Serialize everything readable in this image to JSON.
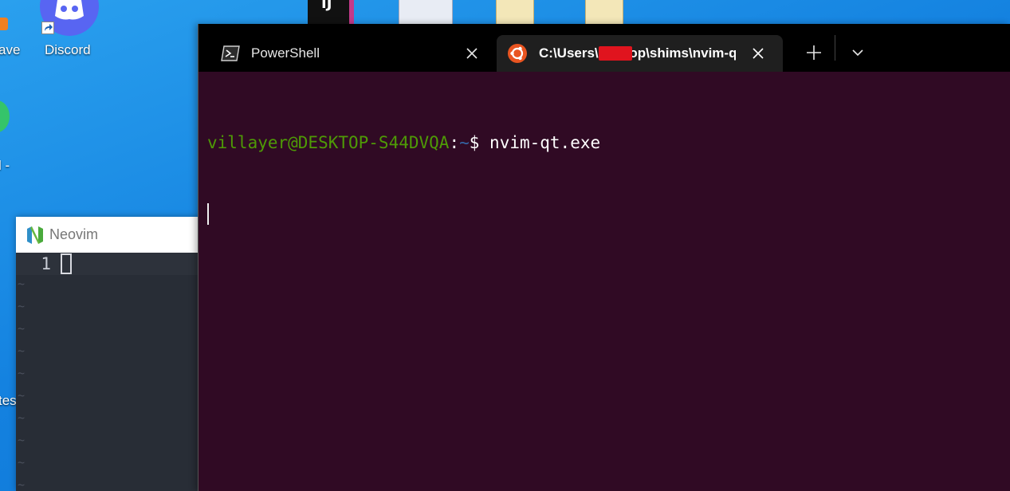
{
  "desktop": {
    "icons": [
      {
        "label": "ave",
        "icon": "app-icon"
      },
      {
        "label": "Discord",
        "icon": "discord-icon"
      },
      {
        "label": "l -",
        "icon": "app-icon"
      },
      {
        "label": "tes",
        "icon": "app-icon"
      }
    ]
  },
  "neovim": {
    "title": "Neovim",
    "line_number": "1",
    "tilde": "~"
  },
  "terminal": {
    "tabs": [
      {
        "title": "PowerShell",
        "icon": "powershell-icon"
      },
      {
        "title": "C:\\Users\\     \\scoop\\shims\\nvim-qt.exe",
        "icon": "ubuntu-icon"
      }
    ],
    "prompt": {
      "user_host": "villayer@DESKTOP-S44DVQA",
      "separator": ":",
      "path": "~",
      "symbol": "$ ",
      "command": "nvim-qt.exe"
    }
  },
  "colors": {
    "terminal_bg": "#300a24",
    "prompt_user": "#4e9a06",
    "prompt_path": "#3465a4",
    "ubuntu_orange": "#e95420",
    "discord_blurple": "#5865f2"
  }
}
